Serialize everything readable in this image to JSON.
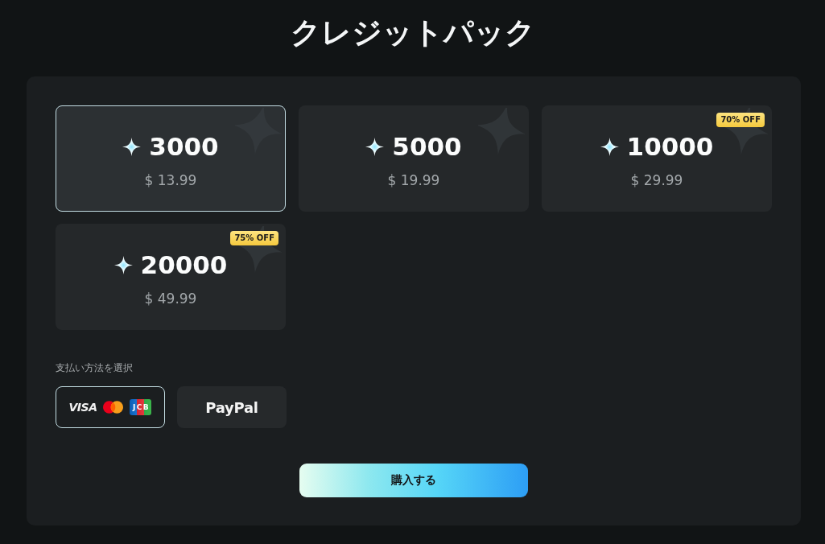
{
  "title": "クレジットパック",
  "packs": [
    {
      "amount": "3000",
      "price": "$ 13.99",
      "selected": true
    },
    {
      "amount": "5000",
      "price": "$ 19.99",
      "selected": false
    },
    {
      "amount": "10000",
      "price": "$ 29.99",
      "badge": "70% OFF",
      "selected": false
    },
    {
      "amount": "20000",
      "price": "$ 49.99",
      "badge": "75% OFF",
      "selected": false
    }
  ],
  "payment": {
    "label": "支払い方法を選択",
    "methods": [
      {
        "kind": "cards",
        "brands": [
          {
            "kind": "visa",
            "label": "VISA"
          },
          {
            "kind": "mastercard"
          },
          {
            "kind": "jcb",
            "label": "JCB"
          }
        ],
        "selected": true
      },
      {
        "kind": "paypal",
        "label": "PayPal",
        "selected": false
      }
    ]
  },
  "buy_button": "購入する"
}
